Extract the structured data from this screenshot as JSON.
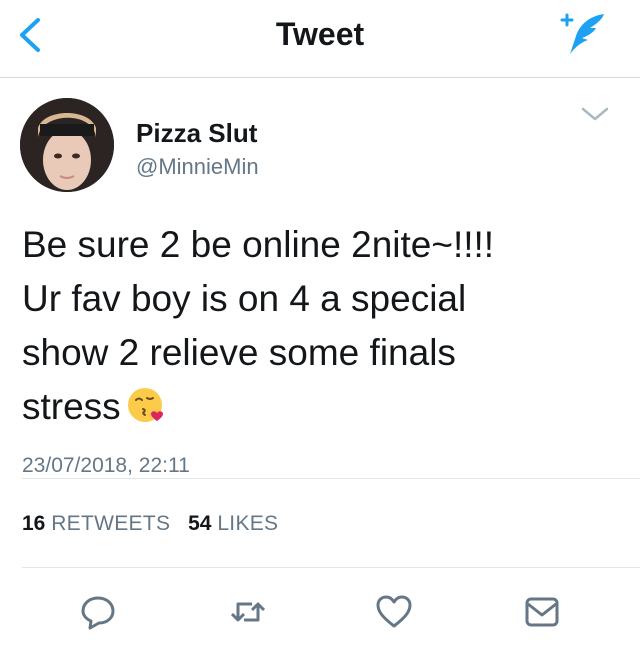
{
  "header": {
    "title": "Tweet",
    "back_icon": "chevron-left-icon",
    "compose_icon": "compose-feather-icon"
  },
  "tweet": {
    "display_name": "Pizza Slut",
    "handle": "@MinnieMin",
    "text": "Be sure 2 be online 2nite~!!!!\nUr fav boy is on 4 a special\nshow 2 relieve some finals\nstress",
    "emoji": "kissing-face-with-heart-emoji",
    "timestamp": "23/07/2018, 22:11",
    "retweets_count": "16",
    "retweets_label": "RETWEETS",
    "likes_count": "54",
    "likes_label": "LIKES",
    "more_icon": "chevron-down-icon"
  },
  "actions": [
    "reply-icon",
    "retweet-icon",
    "like-icon",
    "share-mail-icon"
  ],
  "colors": {
    "accent": "#1da1f2",
    "text": "#14171a",
    "muted": "#657786",
    "divider": "#e1e8ed"
  }
}
